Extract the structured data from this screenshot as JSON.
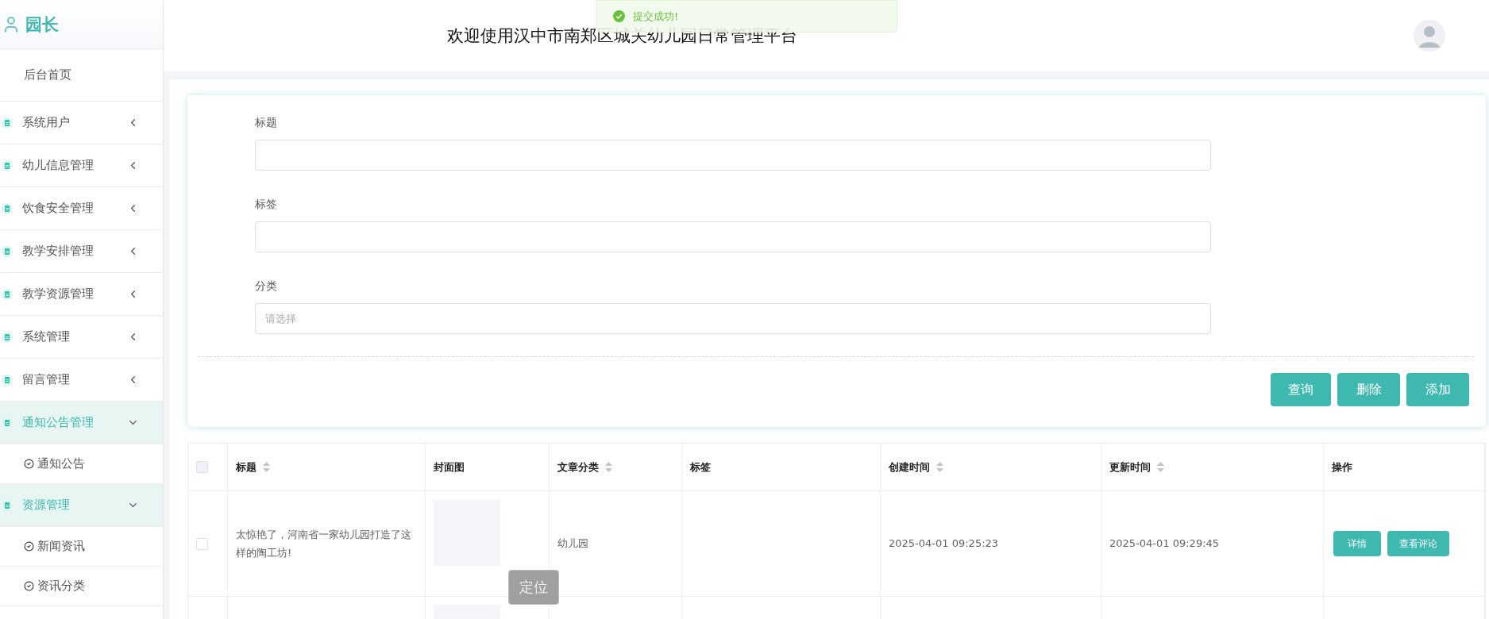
{
  "sidebar": {
    "role": "园长",
    "items": [
      {
        "label": "后台首页",
        "kind": "home"
      },
      {
        "label": "系统用户",
        "kind": "group",
        "expanded": false
      },
      {
        "label": "幼儿信息管理",
        "kind": "group",
        "expanded": false
      },
      {
        "label": "饮食安全管理",
        "kind": "group",
        "expanded": false
      },
      {
        "label": "教学安排管理",
        "kind": "group",
        "expanded": false
      },
      {
        "label": "教学资源管理",
        "kind": "group",
        "expanded": false
      },
      {
        "label": "系统管理",
        "kind": "group",
        "expanded": false
      },
      {
        "label": "留言管理",
        "kind": "group",
        "expanded": false
      },
      {
        "label": "通知公告管理",
        "kind": "group",
        "expanded": true,
        "children": [
          {
            "label": "通知公告"
          }
        ]
      },
      {
        "label": "资源管理",
        "kind": "group",
        "expanded": true,
        "children": [
          {
            "label": "新闻资讯"
          },
          {
            "label": "资讯分类"
          }
        ]
      }
    ]
  },
  "header": {
    "title": "欢迎使用汉中市南郑区城关幼儿园日常管理平台"
  },
  "toast": {
    "kind": "success",
    "message": "提交成功!"
  },
  "form": {
    "fields": [
      {
        "label": "标题"
      },
      {
        "label": "标签"
      },
      {
        "label": "分类",
        "placeholder": "请选择"
      }
    ],
    "buttons": [
      "查询",
      "删除",
      "添加"
    ]
  },
  "table": {
    "select_all": {
      "checked": false
    },
    "columns": [
      {
        "label": "标题",
        "sortable": true
      },
      {
        "label": "封面图",
        "sortable": false
      },
      {
        "label": "文章分类",
        "sortable": true
      },
      {
        "label": "标签",
        "sortable": false
      },
      {
        "label": "创建时间",
        "sortable": true
      },
      {
        "label": "更新时间",
        "sortable": true
      },
      {
        "label": "操作",
        "sortable": false
      }
    ],
    "rows": [
      {
        "checked": false,
        "title": "太惊艳了，河南省一家幼儿园打造了这样的陶工坊!",
        "cover": {
          "kind": "picture"
        },
        "category": "幼儿园",
        "created": "2025-04-01 09:25:23",
        "updated": "2025-04-01 09:29:45",
        "actions": [
          "详情",
          "查看评论"
        ]
      },
      {
        "cover": {
          "kind": "picture"
        }
      }
    ]
  },
  "float_button": "定位"
}
